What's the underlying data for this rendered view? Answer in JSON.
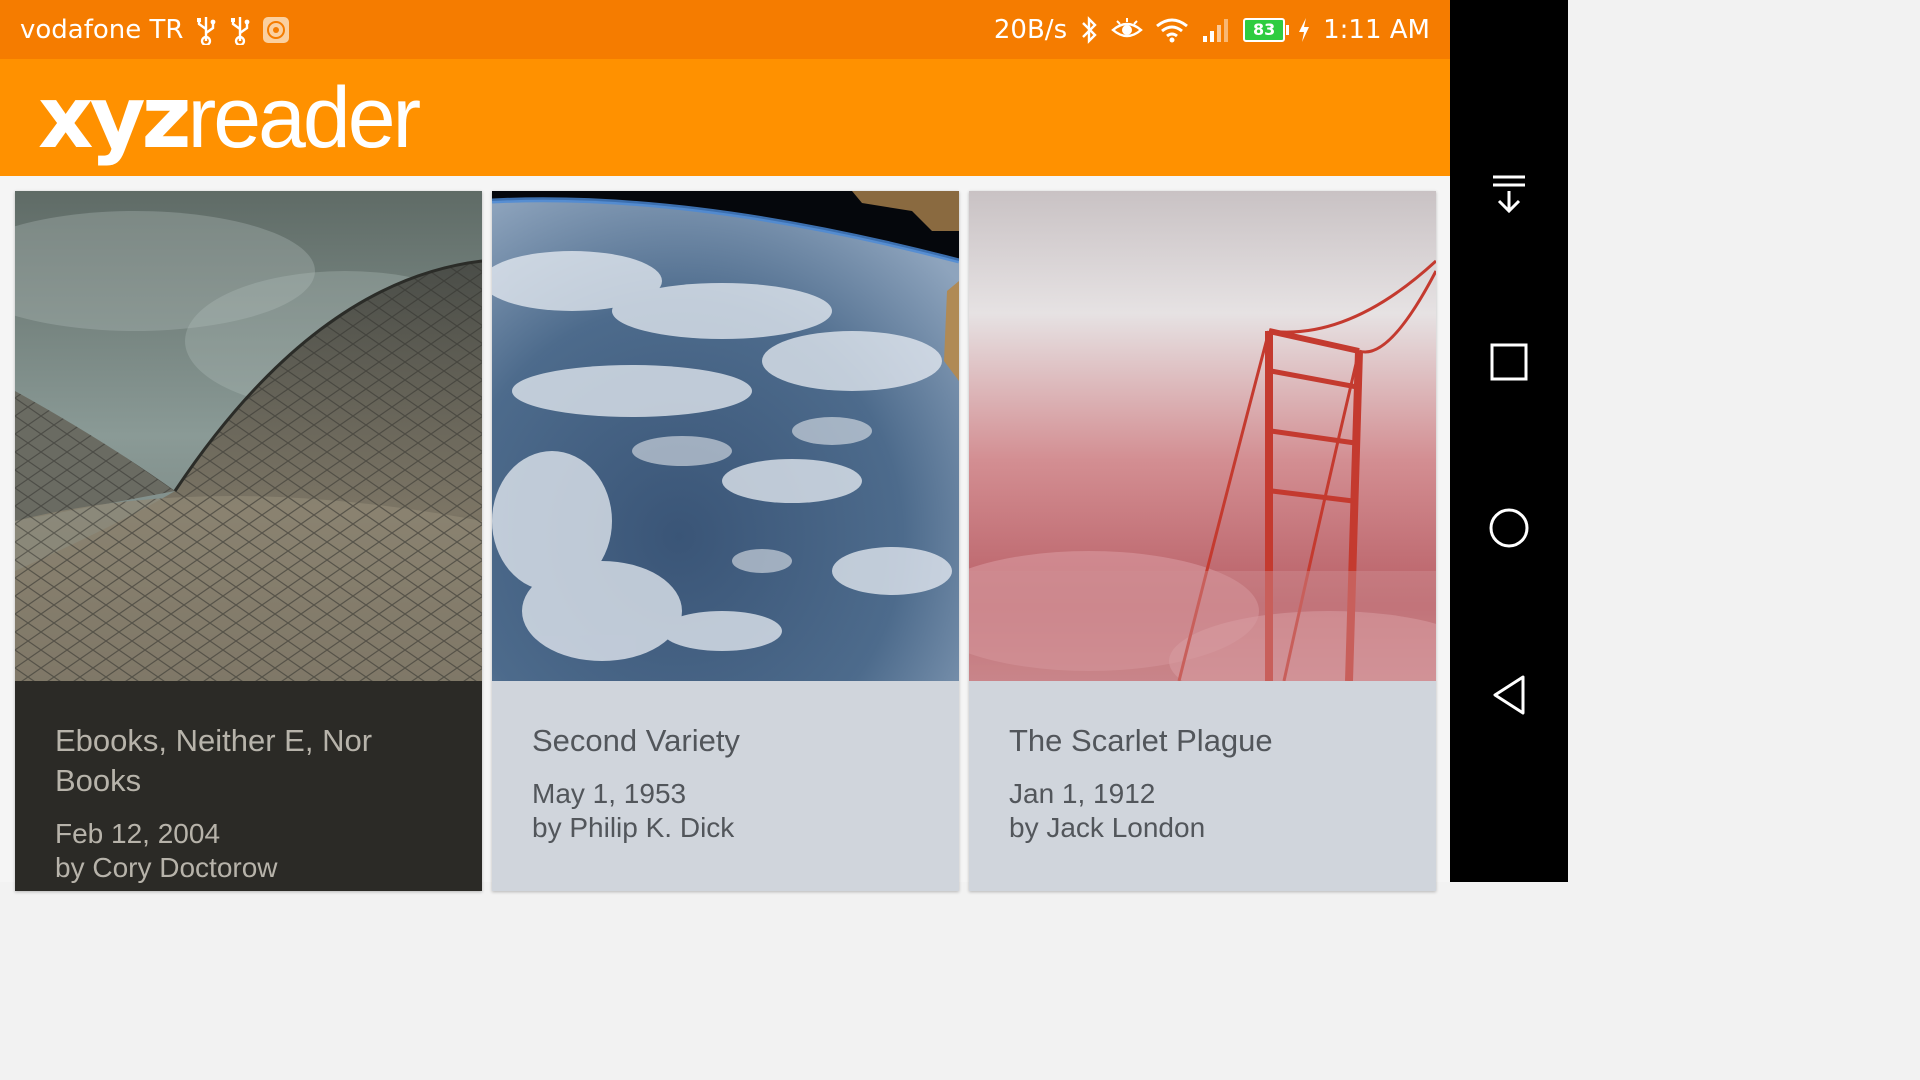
{
  "status_bar": {
    "carrier": "vodafone TR",
    "net_speed": "20B/s",
    "battery": "83",
    "time": "1:11 AM",
    "icons": [
      "usb-icon",
      "usb-icon",
      "mi-app-icon",
      "bluetooth-icon",
      "eye-icon",
      "wifi-icon",
      "signal-icon",
      "battery-icon",
      "charging-icon"
    ]
  },
  "app_bar": {
    "logo_bold": "xyz",
    "logo_light": "reader",
    "color": "#ff9100"
  },
  "articles": [
    {
      "title": "Ebooks, Neither E, Nor Books",
      "date": "Feb 12, 2004",
      "author": "by Cory Doctorow",
      "image": "opera-house-roof"
    },
    {
      "title": "Second Variety",
      "date": "May 1, 1953",
      "author": "by Philip K. Dick",
      "image": "earth-from-space"
    },
    {
      "title": "The Scarlet Plague",
      "date": "Jan 1, 1912",
      "author": "by Jack London",
      "image": "bridge-in-red-fog"
    }
  ],
  "nav_bar": {
    "buttons": [
      "notification-pull-icon",
      "recent-apps-icon",
      "home-icon",
      "back-icon"
    ]
  },
  "colors": {
    "status_bar": "#f57c00",
    "app_bar": "#ff9100",
    "card_dark": "#2b2a26",
    "card_light": "#d0d5dc"
  }
}
